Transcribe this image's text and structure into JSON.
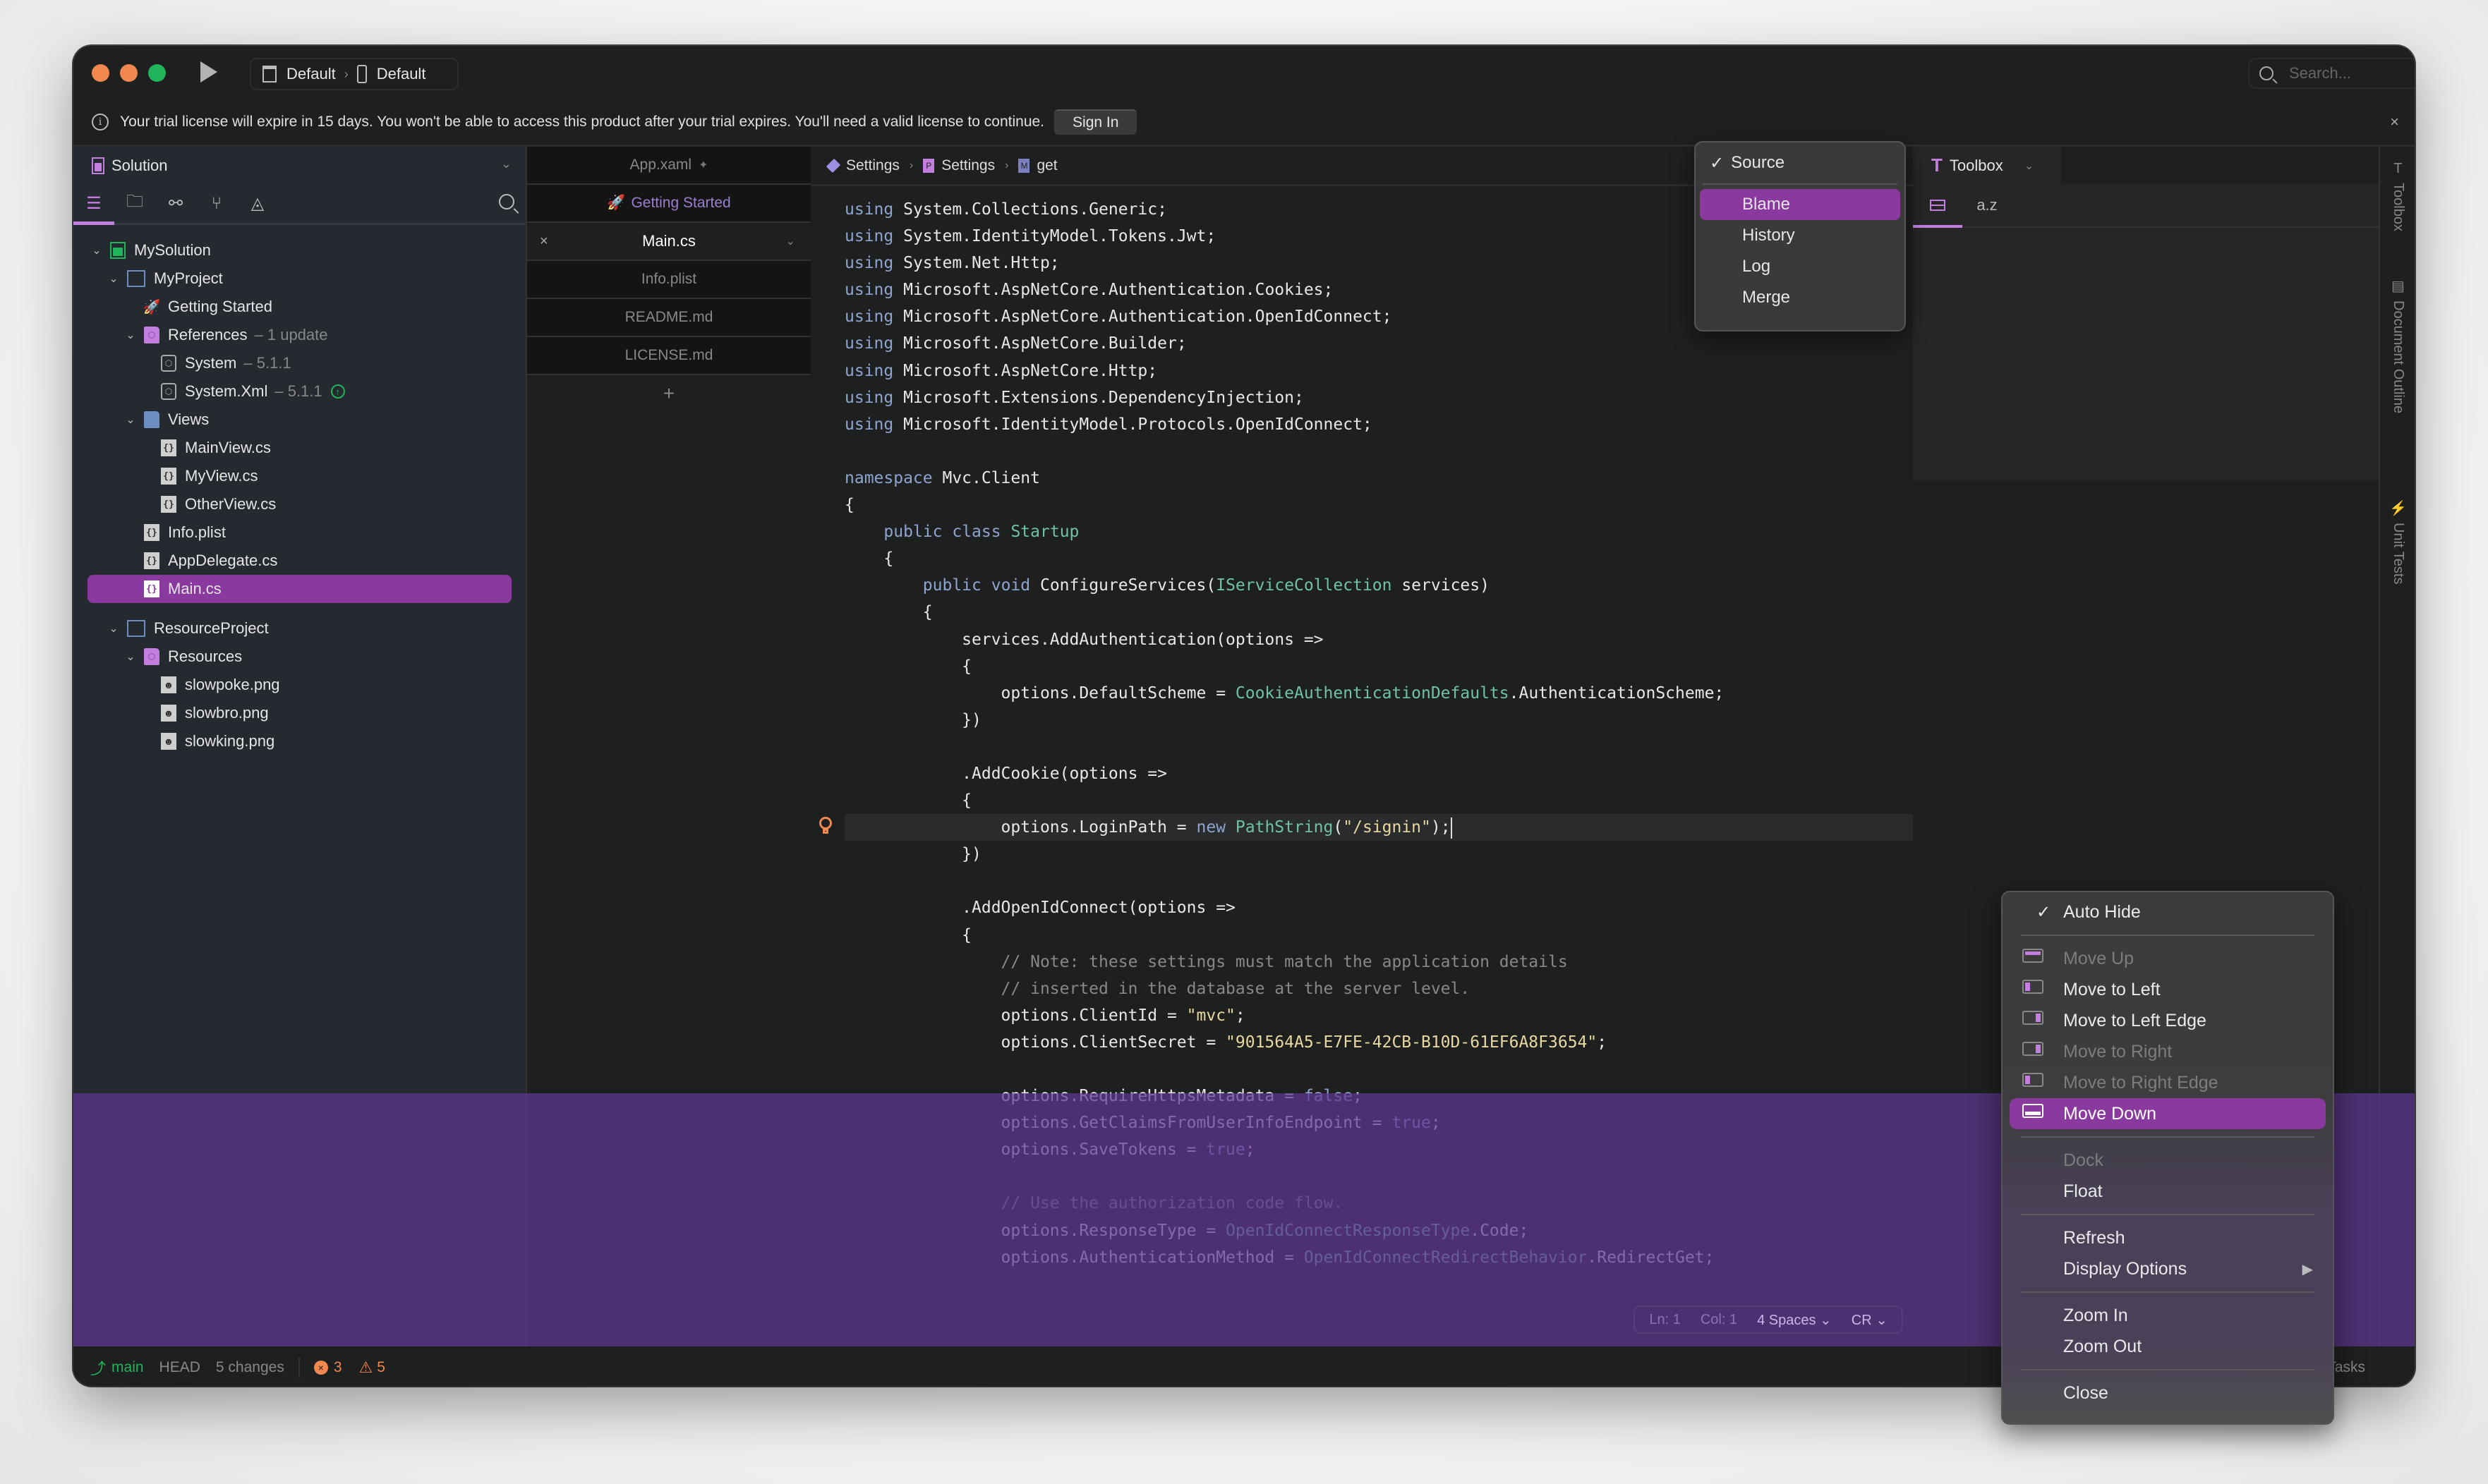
{
  "titlebar": {
    "scheme_config": "Default",
    "scheme_device": "Default",
    "search_placeholder": "Search..."
  },
  "infobar": {
    "message": "Your trial license will expire in 15 days. You won't be able to access this product after your trial expires. You'll need a valid license to continue.",
    "signin_label": "Sign In",
    "close_glyph": "×"
  },
  "sidebar": {
    "title": "Solution",
    "tree": [
      {
        "label": "MySolution",
        "meta": "",
        "icon": "solution-icon"
      },
      {
        "label": "MyProject",
        "meta": "",
        "icon": "project-icon"
      },
      {
        "label": "Getting Started",
        "meta": "",
        "icon": "rocket-icon"
      },
      {
        "label": "References",
        "meta": "– 1 update",
        "icon": "folder-icon"
      },
      {
        "label": "System",
        "meta": "– 5.1.1",
        "icon": "package-icon"
      },
      {
        "label": "System.Xml",
        "meta": "– 5.1.1",
        "icon": "package-icon"
      },
      {
        "label": "Views",
        "meta": "",
        "icon": "folder-icon"
      },
      {
        "label": "MainView.cs",
        "meta": "",
        "icon": "code-file-icon"
      },
      {
        "label": "MyView.cs",
        "meta": "",
        "icon": "code-file-icon"
      },
      {
        "label": "OtherView.cs",
        "meta": "",
        "icon": "code-file-icon"
      },
      {
        "label": "Info.plist",
        "meta": "",
        "icon": "code-file-icon"
      },
      {
        "label": "AppDelegate.cs",
        "meta": "",
        "icon": "code-file-icon"
      },
      {
        "label": "Main.cs",
        "meta": "",
        "icon": "code-file-icon",
        "selected": true
      },
      {
        "label": "ResourceProject",
        "meta": "",
        "icon": "project-icon"
      },
      {
        "label": "Resources",
        "meta": "",
        "icon": "folder-icon"
      },
      {
        "label": "slowpoke.png",
        "meta": "",
        "icon": "image-file-icon"
      },
      {
        "label": "slowbro.png",
        "meta": "",
        "icon": "image-file-icon"
      },
      {
        "label": "slowking.png",
        "meta": "",
        "icon": "image-file-icon"
      }
    ]
  },
  "tabs": {
    "items": [
      {
        "label": "App.xaml",
        "pinned": true
      },
      {
        "label": "Getting Started"
      },
      {
        "label": "Main.cs",
        "active": true
      },
      {
        "label": "Info.plist"
      },
      {
        "label": "README.md"
      },
      {
        "label": "LICENSE.md"
      }
    ],
    "add_glyph": "+"
  },
  "editor": {
    "breadcrumb": [
      {
        "label": "Settings",
        "badge": "C"
      },
      {
        "label": "Settings",
        "badge": "P"
      },
      {
        "label": "get",
        "badge": "M"
      }
    ],
    "code": [
      "using System.Collections.Generic;",
      "using System.IdentityModel.Tokens.Jwt;",
      "using System.Net.Http;",
      "using Microsoft.AspNetCore.Authentication.Cookies;",
      "using Microsoft.AspNetCore.Authentication.OpenIdConnect;",
      "using Microsoft.AspNetCore.Builder;",
      "using Microsoft.AspNetCore.Http;",
      "using Microsoft.Extensions.DependencyInjection;",
      "using Microsoft.IdentityModel.Protocols.OpenIdConnect;",
      "",
      "namespace Mvc.Client",
      "{",
      "    public class Startup",
      "    {",
      "        public void ConfigureServices(IServiceCollection services)",
      "        {",
      "            services.AddAuthentication(options =>",
      "            {",
      "                options.DefaultScheme = CookieAuthenticationDefaults.AuthenticationScheme;",
      "            })",
      "",
      "            .AddCookie(options =>",
      "            {",
      "                options.LoginPath = new PathString(\"/signin\");",
      "            })",
      "",
      "            .AddOpenIdConnect(options =>",
      "            {",
      "                // Note: these settings must match the application details",
      "                // inserted in the database at the server level.",
      "                options.ClientId = \"mvc\";",
      "                options.ClientSecret = \"901564A5-E7FE-42CB-B10D-61EF6A8F3654\";",
      "",
      "                options.RequireHttpsMetadata = false;",
      "                options.GetClaimsFromUserInfoEndpoint = true;",
      "                options.SaveTokens = true;",
      "",
      "                // Use the authorization code flow.",
      "                options.ResponseType = OpenIdConnectResponseType.Code;",
      "                options.AuthenticationMethod = OpenIdConnectRedirectBehavior.RedirectGet;"
    ],
    "current_line_index": 23,
    "status": {
      "line": "Ln: 1",
      "col": "Col: 1",
      "indent": "4 Spaces",
      "line_ending": "CR"
    }
  },
  "source_menu": {
    "header": "Source",
    "items": [
      {
        "label": "Blame",
        "selected": true
      },
      {
        "label": "History"
      },
      {
        "label": "Log"
      },
      {
        "label": "Merge"
      }
    ]
  },
  "toolbox": {
    "title": "Toolbox",
    "sort_label": "a.z"
  },
  "rail": {
    "items": [
      "Toolbox",
      "Document Outline",
      "Unit Tests"
    ]
  },
  "statusbar": {
    "branch": "main",
    "head": "HEAD",
    "changes": "5 changes",
    "errors": "3",
    "warnings": "5",
    "tasks": "Tasks"
  },
  "context_menu": {
    "auto_hide": "Auto Hide",
    "move_items": [
      {
        "label": "Move Up",
        "disabled": true,
        "dock": "top"
      },
      {
        "label": "Move to Left",
        "disabled": false,
        "dock": "left"
      },
      {
        "label": "Move to Left Edge",
        "disabled": false,
        "dock": "right"
      },
      {
        "label": "Move to Right",
        "disabled": true,
        "dock": "right"
      },
      {
        "label": "Move to Right Edge",
        "disabled": true,
        "dock": "left"
      },
      {
        "label": "Move Down",
        "disabled": false,
        "dock": "bottom",
        "selected": true
      }
    ],
    "dock": "Dock",
    "float": "Float",
    "refresh": "Refresh",
    "display_options": "Display Options",
    "zoom_in": "Zoom In",
    "zoom_out": "Zoom Out",
    "close": "Close"
  },
  "colors": {
    "accent": "#8a3a9e",
    "accent_light": "#c27fe0",
    "success": "#22b45a",
    "warning": "#f0884f",
    "background": "#1e1f1f",
    "sidebar_bg": "#252930"
  }
}
